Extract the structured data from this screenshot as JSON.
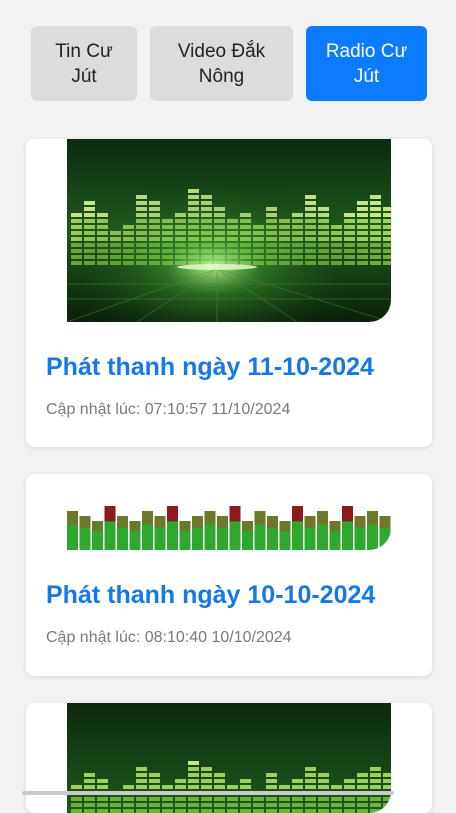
{
  "tabs": [
    {
      "label": "Tin Cư Jút",
      "active": false
    },
    {
      "label": "Video Đắk Nông",
      "active": false
    },
    {
      "label": "Radio Cư Jút",
      "active": true
    }
  ],
  "colors": {
    "accent": "#0b7cff",
    "title": "#1479e6",
    "meta": "#7a7a7a",
    "tab_bg": "#dcdcdc"
  },
  "posts": [
    {
      "title": "Phát thanh ngày 11-10-2024",
      "updated": "Cập nhật lúc: 07:10:57 11/10/2024",
      "thumbnail": "green-equalizer-visualizer"
    },
    {
      "title": "Phát thanh ngày 10-10-2024",
      "updated": "Cập nhật lúc: 08:10:40 10/10/2024",
      "thumbnail": "red-green-equalizer-bars"
    },
    {
      "title": "",
      "updated": "",
      "thumbnail": "green-equalizer-visualizer"
    }
  ]
}
